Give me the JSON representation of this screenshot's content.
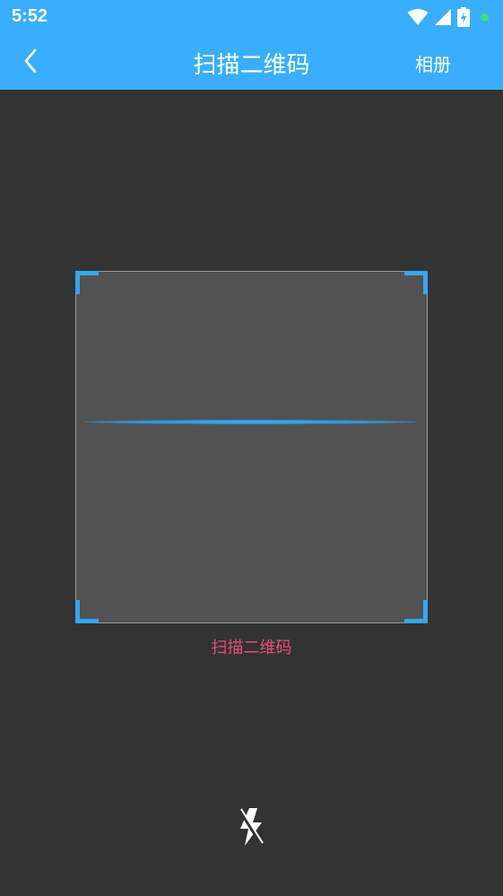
{
  "status_bar": {
    "time": "5:52",
    "icons": [
      "wifi-icon",
      "cell-signal-icon",
      "battery-charging-icon",
      "notification-dot-icon"
    ]
  },
  "header": {
    "back_icon": "chevron-left-icon",
    "title": "扫描二维码",
    "album_label": "相册"
  },
  "scanner": {
    "hint": "扫描二维码",
    "flash_icon": "flash-off-icon"
  },
  "colors": {
    "header_background": "#3aaefb",
    "page_background": "#333333",
    "frame_fill": "#525252",
    "corner_accent": "#36a7f3",
    "hint_text": "#e84c7a",
    "status_dot": "#3ee07a"
  }
}
